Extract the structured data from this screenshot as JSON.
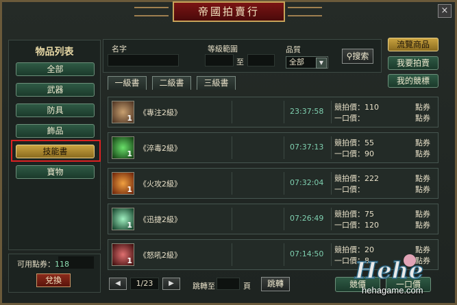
{
  "window": {
    "title": "帝國拍賣行",
    "close_label": "×"
  },
  "sidebar": {
    "title": "物品列表",
    "items": [
      {
        "label": "全部",
        "selected": false
      },
      {
        "label": "武器",
        "selected": false
      },
      {
        "label": "防具",
        "selected": false
      },
      {
        "label": "飾品",
        "selected": false
      },
      {
        "label": "技能書",
        "selected": true
      },
      {
        "label": "寶物",
        "selected": false
      }
    ]
  },
  "points": {
    "label": "可用點券：",
    "value": "118",
    "exchange_label": "兌換"
  },
  "search": {
    "name_label": "名字",
    "level_label": "等級範圍",
    "level_to": "至",
    "quality_label": "品質",
    "quality_value": "全部",
    "search_label": "搜索"
  },
  "right_menu": [
    {
      "label": "流覽商品",
      "selected": true
    },
    {
      "label": "我要拍賣",
      "selected": false
    },
    {
      "label": "我的競標",
      "selected": false
    }
  ],
  "tabs": [
    "一級書",
    "二級書",
    "三級書"
  ],
  "listings": [
    {
      "name": "《專注2級》",
      "level": "1",
      "time": "23:37:58",
      "bid_label": "競拍價：",
      "bid": "110",
      "buy_label": "一口價：",
      "buy": "",
      "unit": "點券",
      "icon_color": "#7a5a3a"
    },
    {
      "name": "《淬毒2級》",
      "level": "1",
      "time": "07:37:13",
      "bid_label": "競拍價：",
      "bid": "55",
      "buy_label": "一口價：",
      "buy": "90",
      "unit": "點券",
      "icon_color": "#2a8a2a"
    },
    {
      "name": "《火攻2級》",
      "level": "1",
      "time": "07:32:04",
      "bid_label": "競拍價：",
      "bid": "222",
      "buy_label": "一口價：",
      "buy": "",
      "unit": "點券",
      "icon_color": "#c8501a"
    },
    {
      "name": "《迅捷2級》",
      "level": "1",
      "time": "07:26:49",
      "bid_label": "競拍價：",
      "bid": "75",
      "buy_label": "一口價：",
      "buy": "120",
      "unit": "點券",
      "icon_color": "#3aa070"
    },
    {
      "name": "《怒吼2級》",
      "level": "1",
      "time": "07:14:50",
      "bid_label": "競拍價：",
      "bid": "20",
      "buy_label": "一口價：",
      "buy": "8",
      "unit": "點券",
      "icon_color": "#a03030"
    }
  ],
  "pager": {
    "page": "1/23",
    "jump_label": "跳轉至",
    "page_unit": "頁",
    "go_label": "跳轉"
  },
  "bottom_buttons": [
    "競價",
    "一口價"
  ],
  "watermark": {
    "logo": "Hehe",
    "url": "hehagame.com"
  }
}
